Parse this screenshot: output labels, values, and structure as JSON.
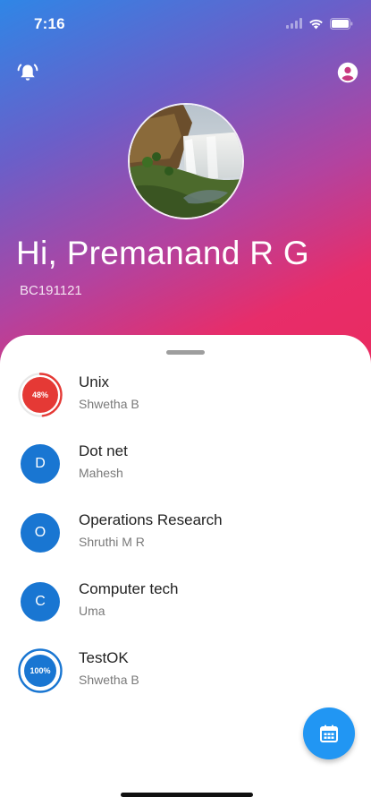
{
  "status_bar": {
    "time": "7:16"
  },
  "header": {
    "greeting": "Hi, Premanand R G",
    "user_id": "BC191121",
    "icons": {
      "left": "bell-alert-icon",
      "right": "account-circle-icon"
    }
  },
  "courses": [
    {
      "name": "Unix",
      "teacher": "Shwetha B",
      "progress_label": "48%",
      "progress": 0.48,
      "color": "#e53935",
      "type": "progress"
    },
    {
      "name": "Dot net",
      "teacher": "Mahesh",
      "letter": "D",
      "color": "#1976d2",
      "type": "letter"
    },
    {
      "name": "Operations Research",
      "teacher": "Shruthi M R",
      "letter": "O",
      "color": "#1976d2",
      "type": "letter"
    },
    {
      "name": "Computer tech",
      "teacher": "Uma",
      "letter": "C",
      "color": "#1976d2",
      "type": "letter"
    },
    {
      "name": "TestOK",
      "teacher": "Shwetha B",
      "progress_label": "100%",
      "progress": 1.0,
      "color": "#1976d2",
      "type": "progress"
    }
  ],
  "fab": {
    "icon": "calendar-icon"
  },
  "colors": {
    "accent": "#2196f3",
    "gradient_start": "#2f86e6",
    "gradient_end": "#ea2a5f"
  }
}
